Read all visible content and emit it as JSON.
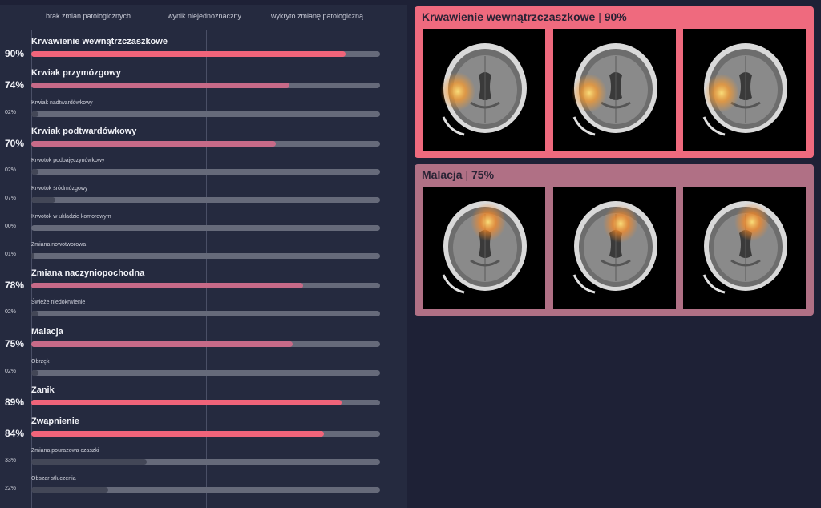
{
  "scale_headers": {
    "left": "brak zmian patologicznych",
    "middle": "wynik niejednoznaczny",
    "right": "wykryto zmianę patologiczną"
  },
  "findings": [
    {
      "label": "Krwawienie wewnątrzczaszkowe",
      "percent": "90%",
      "value": 0.9,
      "emphasis": true
    },
    {
      "label": "Krwiak przymózgowy",
      "percent": "74%",
      "value": 0.74,
      "emphasis": true
    },
    {
      "label": "Krwiak nadtwardówkowy",
      "percent": "02%",
      "value": 0.02,
      "emphasis": false
    },
    {
      "label": "Krwiak podtwardówkowy",
      "percent": "70%",
      "value": 0.7,
      "emphasis": true
    },
    {
      "label": "Krwotok podpajęczynówkowy",
      "percent": "02%",
      "value": 0.02,
      "emphasis": false
    },
    {
      "label": "Krwotok śródmózgowy",
      "percent": "07%",
      "value": 0.07,
      "emphasis": false
    },
    {
      "label": "Krwotok w układzie komorowym",
      "percent": "00%",
      "value": 0.0,
      "emphasis": false
    },
    {
      "label": "Zmiana nowotworowa",
      "percent": "01%",
      "value": 0.01,
      "emphasis": false
    },
    {
      "label": "Zmiana naczyniopochodna",
      "percent": "78%",
      "value": 0.78,
      "emphasis": true
    },
    {
      "label": "Świeże niedokrwienie",
      "percent": "02%",
      "value": 0.02,
      "emphasis": false
    },
    {
      "label": "Malacja",
      "percent": "75%",
      "value": 0.75,
      "emphasis": true
    },
    {
      "label": "Obrzęk",
      "percent": "02%",
      "value": 0.02,
      "emphasis": false
    },
    {
      "label": "Zanik",
      "percent": "89%",
      "value": 0.89,
      "emphasis": true
    },
    {
      "label": "Zwapnienie",
      "percent": "84%",
      "value": 0.84,
      "emphasis": true
    },
    {
      "label": "Zmiana pourazowa czaszki",
      "percent": "33%",
      "value": 0.33,
      "emphasis": false
    },
    {
      "label": "Obszar stłuczenia",
      "percent": "22%",
      "value": 0.22,
      "emphasis": false
    }
  ],
  "colors": {
    "strong_fill": "#f0647a",
    "medium_fill": "#c76a88",
    "weak_fill": "#434757",
    "track": "#666a7a",
    "card_1": "#ef6a7e",
    "card_2": "#b07085"
  },
  "cards": [
    {
      "label": "Krwawienie wewnątrzczaszkowe",
      "percent": "90%",
      "images": [
        {
          "icon": "ct-scan-icon",
          "heat": "left"
        },
        {
          "icon": "ct-scan-icon",
          "heat": "left"
        },
        {
          "icon": "ct-scan-icon",
          "heat": "left"
        }
      ]
    },
    {
      "label": "Malacja",
      "percent": "75%",
      "images": [
        {
          "icon": "ct-scan-icon",
          "heat": "top-right"
        },
        {
          "icon": "ct-scan-icon",
          "heat": "top-right"
        },
        {
          "icon": "ct-scan-icon",
          "heat": "top-right"
        }
      ]
    }
  ]
}
